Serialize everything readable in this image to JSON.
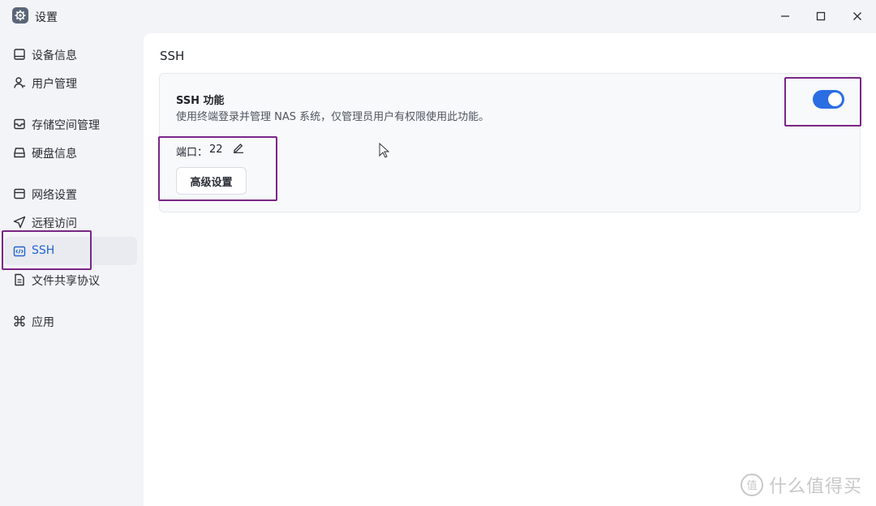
{
  "window": {
    "title": "设置",
    "app_icon": "gear-icon",
    "controls": [
      "minimize-icon",
      "maximize-icon",
      "close-icon"
    ]
  },
  "sidebar": {
    "items": [
      {
        "label": "设备信息",
        "icon": "device-icon"
      },
      {
        "label": "用户管理",
        "icon": "user-icon"
      },
      {
        "label": "存储空间管理",
        "icon": "storage-icon"
      },
      {
        "label": "硬盘信息",
        "icon": "disk-icon"
      },
      {
        "label": "网络设置",
        "icon": "network-icon"
      },
      {
        "label": "远程访问",
        "icon": "remote-icon"
      },
      {
        "label": "SSH",
        "icon": "code-icon",
        "active": true
      },
      {
        "label": "文件共享协议",
        "icon": "file-icon"
      },
      {
        "label": "应用",
        "icon": "apps-icon"
      }
    ]
  },
  "main": {
    "title": "SSH",
    "ssh_card": {
      "title": "SSH 功能",
      "description": "使用终端登录并管理 NAS 系统，仅管理员用户有权限使用此功能。",
      "enabled": true,
      "port_label": "端口：",
      "port_value": "22",
      "advanced_button": "高级设置"
    }
  },
  "watermark": {
    "text": "什么值得买",
    "logo": "值"
  },
  "colors": {
    "accent": "#2b6ee3",
    "active_text": "#2264d1",
    "highlight": "#7a2687",
    "sidebar_bg": "#f3f4f8"
  }
}
